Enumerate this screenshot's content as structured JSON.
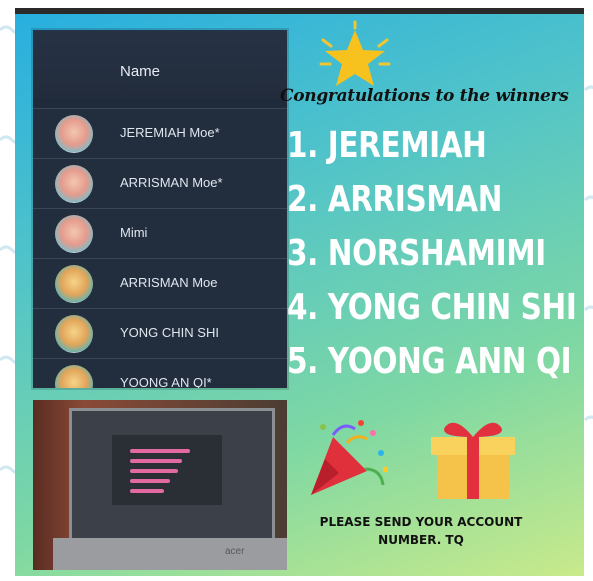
{
  "name_list": {
    "header": "Name",
    "rows": [
      {
        "name": "JEREMIAH Moe*",
        "avatar": "a"
      },
      {
        "name": "ARRISMAN Moe*",
        "avatar": "a"
      },
      {
        "name": "Mimi",
        "avatar": "a"
      },
      {
        "name": "ARRISMAN Moe",
        "avatar": "b"
      },
      {
        "name": "YONG CHIN SHI",
        "avatar": "b"
      },
      {
        "name": "YOONG AN QI*",
        "avatar": "b"
      }
    ]
  },
  "headline": "Congratulations to the winners",
  "winners": [
    "1.  JEREMIAH",
    "2.    ARRISMAN",
    "3. NORSHAMIMI",
    "4. YONG CHIN SHI",
    "5. YOONG ANN QI"
  ],
  "footer": {
    "line1": "PLEASE SEND YOUR ACCOUNT",
    "line2": "NUMBER. TQ"
  },
  "laptop_brand": "acer",
  "icons": [
    "star-icon",
    "party-popper-icon",
    "gift-icon"
  ],
  "colors": {
    "gradient_start": "#27aee0",
    "gradient_end": "#c9ea8b",
    "winner_text": "#ffffff"
  }
}
